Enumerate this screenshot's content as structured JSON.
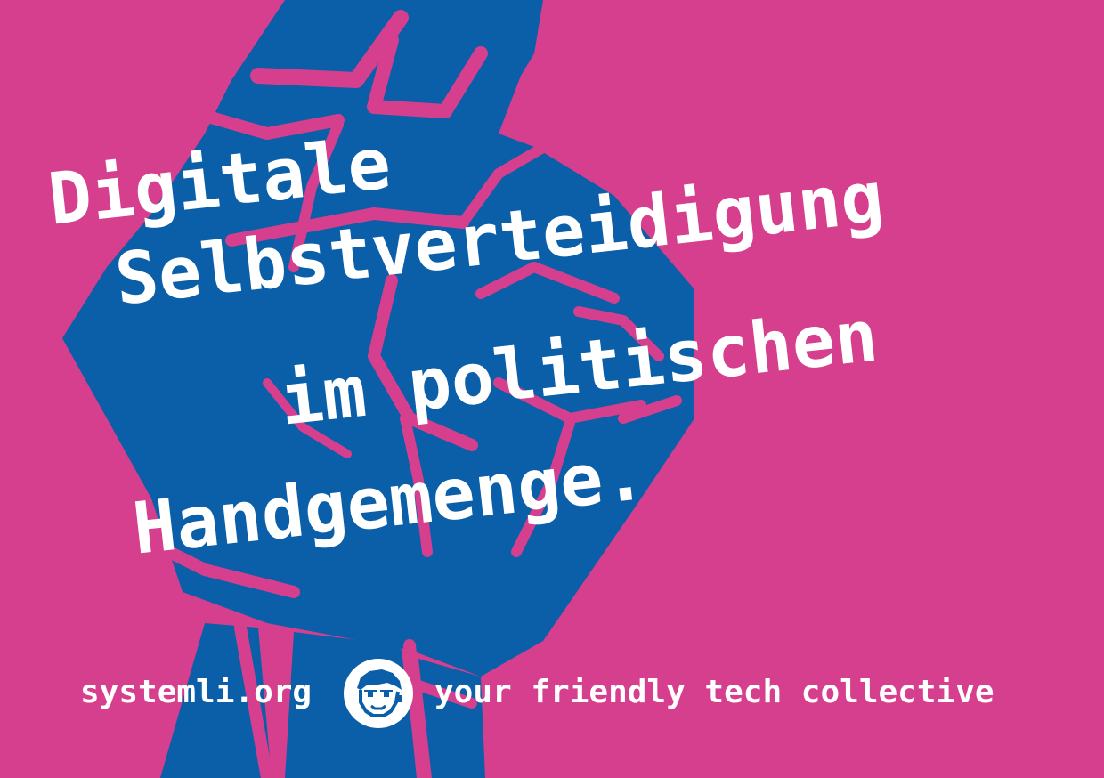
{
  "headline": {
    "line1": "Digitale",
    "line2": "Selbstverteidigung",
    "line3": "im politischen",
    "line4": "Handgemenge."
  },
  "footer": {
    "url": "systemli.org",
    "tagline": "your friendly tech collective",
    "logo_icon": "smiley-face-logo-icon"
  },
  "colors": {
    "background": "#d63f8d",
    "fist": "#0a5fa8",
    "text": "#ffffff"
  }
}
